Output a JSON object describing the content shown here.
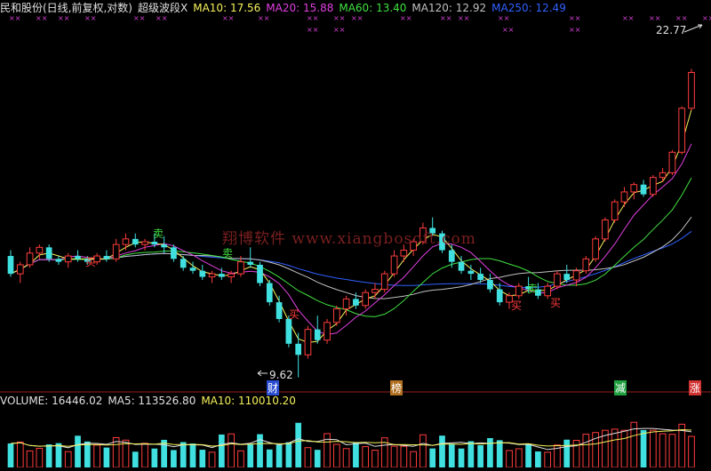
{
  "header": {
    "stock": "民和股份(日线,前复权,对数)",
    "indicator": "超级波段X",
    "ma10": {
      "label": "MA10:",
      "value": "17.56",
      "color": "#f5f05a"
    },
    "ma20": {
      "label": "MA20:",
      "value": "15.88",
      "color": "#e040e0"
    },
    "ma60": {
      "label": "MA60:",
      "value": "13.40",
      "color": "#40e040"
    },
    "ma120": {
      "label": "MA120:",
      "value": "12.92",
      "color": "#c0c0c0"
    },
    "ma250": {
      "label": "MA250:",
      "value": "12.49",
      "color": "#3060ff"
    }
  },
  "volume_header": {
    "volume": "VOLUME: 16446.02",
    "ma5": "MA5: 113526.80",
    "ma10": "MA10: 110010.20"
  },
  "watermark": "翔博软件 www.xiangbosoft.com",
  "price_annotations": {
    "high": "22.77",
    "low": "9.62"
  },
  "signals": {
    "buy": "买",
    "sell": "卖"
  },
  "bottom_tags": [
    {
      "text": "财",
      "bg": "#2a4cd0"
    },
    {
      "text": "榜",
      "bg": "#b07020"
    },
    {
      "text": "减",
      "bg": "#20a040"
    },
    {
      "text": "涨",
      "bg": "#d03030"
    }
  ],
  "marker_glyph": "××",
  "colors": {
    "up": "#ff3c3c",
    "down": "#40e0e0",
    "ma10": "#f5f05a",
    "ma20": "#e040e0",
    "ma60": "#40e040",
    "ma120": "#c0c0c0",
    "ma250": "#3060ff"
  },
  "chart_data": {
    "type": "candlestick",
    "scale": "log",
    "ylim": [
      9.5,
      24
    ],
    "candles_ohlc": [
      [
        13.2,
        13.4,
        12.5,
        12.6
      ],
      [
        12.6,
        13.0,
        12.3,
        12.9
      ],
      [
        12.9,
        13.5,
        12.8,
        13.3
      ],
      [
        13.3,
        13.6,
        13.1,
        13.5
      ],
      [
        13.5,
        13.6,
        13.0,
        13.1
      ],
      [
        13.1,
        13.2,
        12.9,
        13.0
      ],
      [
        13.0,
        13.3,
        12.8,
        13.2
      ],
      [
        13.2,
        13.4,
        13.0,
        13.1
      ],
      [
        13.1,
        13.2,
        12.9,
        13.0
      ],
      [
        13.0,
        13.3,
        12.9,
        13.2
      ],
      [
        13.2,
        13.4,
        13.0,
        13.1
      ],
      [
        13.1,
        13.8,
        13.0,
        13.6
      ],
      [
        13.6,
        14.0,
        13.4,
        13.8
      ],
      [
        13.8,
        14.0,
        13.5,
        13.6
      ],
      [
        13.6,
        13.8,
        13.4,
        13.7
      ],
      [
        13.7,
        14.0,
        13.5,
        13.6
      ],
      [
        13.6,
        13.9,
        13.3,
        13.5
      ],
      [
        13.5,
        13.6,
        13.0,
        13.1
      ],
      [
        13.1,
        13.2,
        12.7,
        12.8
      ],
      [
        12.8,
        13.0,
        12.6,
        12.7
      ],
      [
        12.7,
        12.9,
        12.4,
        12.5
      ],
      [
        12.5,
        12.7,
        12.3,
        12.6
      ],
      [
        12.6,
        12.8,
        12.4,
        12.5
      ],
      [
        12.5,
        12.7,
        12.3,
        12.6
      ],
      [
        12.6,
        13.2,
        12.5,
        13.0
      ],
      [
        13.0,
        13.5,
        12.8,
        12.9
      ],
      [
        12.9,
        13.0,
        12.2,
        12.3
      ],
      [
        12.3,
        12.4,
        11.6,
        11.7
      ],
      [
        11.7,
        11.9,
        11.1,
        11.2
      ],
      [
        11.2,
        11.3,
        10.4,
        10.5
      ],
      [
        10.5,
        10.8,
        9.62,
        10.2
      ],
      [
        10.2,
        11.0,
        10.1,
        10.9
      ],
      [
        10.9,
        11.3,
        10.5,
        10.6
      ],
      [
        10.6,
        11.2,
        10.5,
        11.1
      ],
      [
        11.1,
        11.6,
        11.0,
        11.5
      ],
      [
        11.5,
        11.9,
        11.3,
        11.8
      ],
      [
        11.8,
        12.0,
        11.5,
        11.6
      ],
      [
        11.6,
        12.1,
        11.5,
        12.0
      ],
      [
        12.0,
        12.3,
        11.8,
        12.1
      ],
      [
        12.1,
        12.7,
        12.0,
        12.6
      ],
      [
        12.6,
        13.4,
        12.5,
        13.2
      ],
      [
        13.2,
        13.6,
        13.0,
        13.4
      ],
      [
        13.4,
        13.8,
        13.2,
        13.7
      ],
      [
        13.7,
        14.4,
        13.6,
        14.2
      ],
      [
        14.2,
        14.6,
        13.9,
        14.0
      ],
      [
        14.0,
        14.1,
        13.3,
        13.4
      ],
      [
        13.4,
        13.6,
        12.8,
        13.0
      ],
      [
        13.0,
        13.2,
        12.6,
        12.7
      ],
      [
        12.7,
        12.9,
        12.4,
        12.6
      ],
      [
        12.6,
        12.8,
        12.3,
        12.4
      ],
      [
        12.4,
        12.6,
        12.0,
        12.1
      ],
      [
        12.1,
        12.3,
        11.6,
        11.7
      ],
      [
        11.7,
        12.0,
        11.5,
        11.9
      ],
      [
        11.9,
        12.3,
        11.8,
        12.2
      ],
      [
        12.2,
        12.5,
        12.0,
        12.1
      ],
      [
        12.1,
        12.3,
        11.8,
        11.9
      ],
      [
        11.9,
        12.3,
        11.8,
        12.2
      ],
      [
        12.2,
        12.7,
        12.1,
        12.6
      ],
      [
        12.6,
        12.9,
        12.3,
        12.4
      ],
      [
        12.4,
        12.8,
        12.2,
        12.7
      ],
      [
        12.7,
        13.2,
        12.6,
        13.1
      ],
      [
        13.1,
        13.9,
        13.0,
        13.8
      ],
      [
        13.8,
        14.6,
        13.7,
        14.5
      ],
      [
        14.5,
        15.3,
        14.4,
        15.2
      ],
      [
        15.2,
        15.8,
        15.0,
        15.6
      ],
      [
        15.6,
        16.0,
        15.3,
        15.9
      ],
      [
        15.9,
        16.1,
        15.4,
        15.5
      ],
      [
        15.5,
        16.3,
        15.4,
        16.2
      ],
      [
        16.2,
        16.6,
        16.0,
        16.4
      ],
      [
        16.4,
        17.4,
        16.3,
        17.3
      ],
      [
        17.3,
        19.5,
        17.2,
        19.4
      ],
      [
        19.4,
        21.5,
        19.3,
        21.3
      ]
    ],
    "volume_ma_values": {
      "ma5": 113526.8,
      "ma10": 110010.2
    },
    "last_volume": 16446.02
  }
}
